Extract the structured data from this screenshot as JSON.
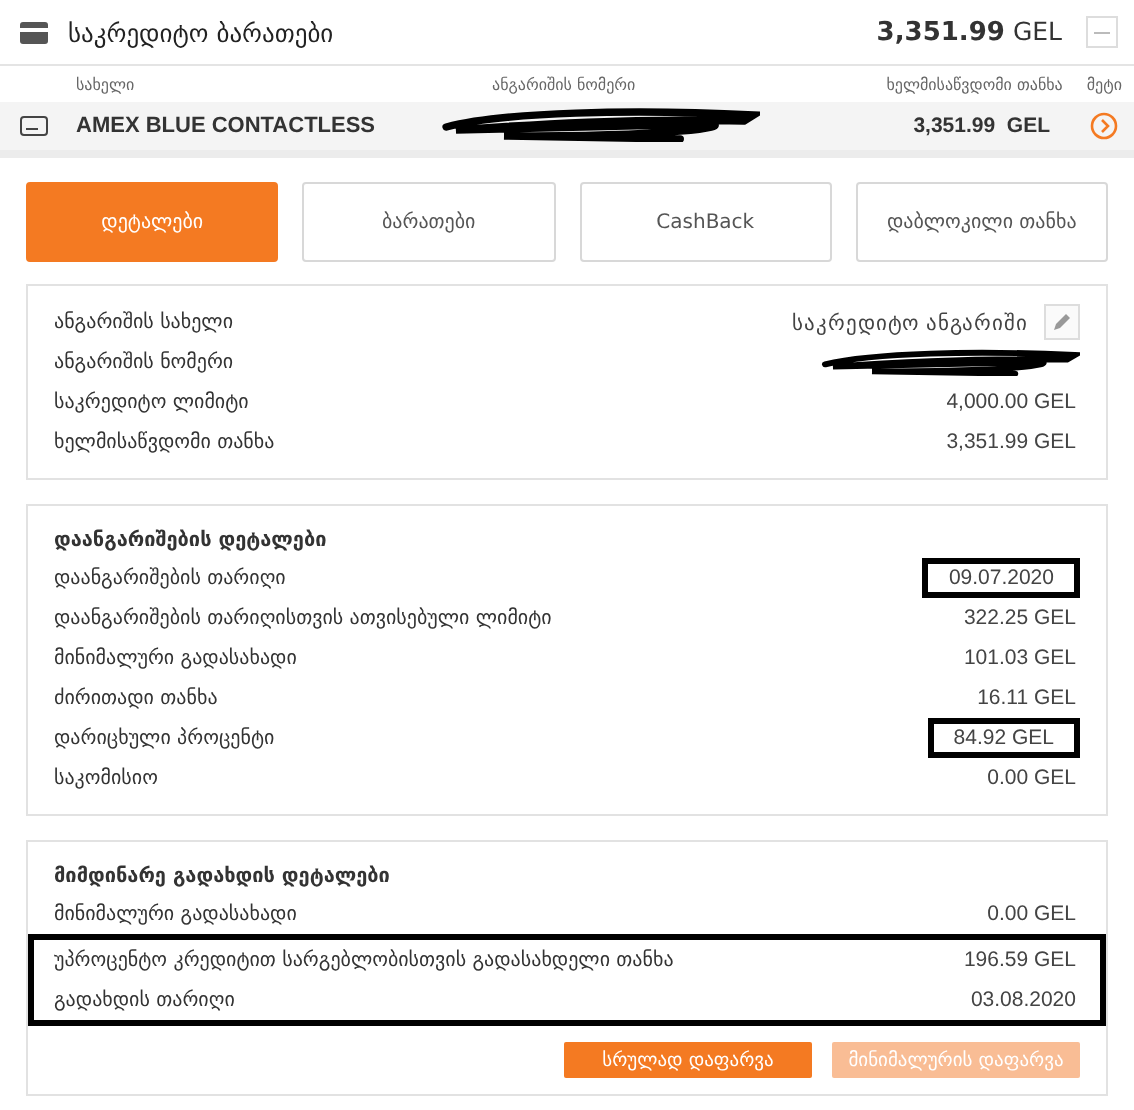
{
  "header": {
    "title": "საკრედიტო ბარათები",
    "amount": "3,351.99",
    "currency": "GEL"
  },
  "columns": [
    "სახელი",
    "ანგარიშის ნომერი",
    "ხელმისაწვდომი თანხა",
    "მეტი"
  ],
  "card": {
    "name": "AMEX BLUE CONTACTLESS",
    "amount": "3,351.99",
    "currency": "GEL",
    "number_redacted": true
  },
  "tabs": [
    {
      "label": "დეტალები",
      "selected": true
    },
    {
      "label": "ბარათები",
      "selected": false
    },
    {
      "label": "CashBack",
      "selected": false
    },
    {
      "label": "დაბლოკილი თანხა",
      "selected": false
    }
  ],
  "sections": [
    {
      "rows": [
        {
          "label": "ანგარიშის სახელი",
          "value": "საკრედიტო ანგარიში",
          "editable": true
        },
        {
          "label": "ანგარიშის ნომერი",
          "redacted": true
        },
        {
          "label": "საკრედიტო ლიმიტი",
          "value": "4,000.00 GEL"
        },
        {
          "label": "ხელმისაწვდომი თანხა",
          "value": "3,351.99 GEL"
        }
      ]
    },
    {
      "title": "დაანგარიშების დეტალები",
      "rows": [
        {
          "label": "დაანგარიშების თარიღი",
          "value": "09.07.2020",
          "value_framed": true
        },
        {
          "label": "დაანგარიშების თარიღისთვის ათვისებული ლიმიტი",
          "value": "322.25 GEL"
        },
        {
          "label": "მინიმალური გადასახადი",
          "value": "101.03 GEL"
        },
        {
          "label": "ძირითადი თანხა",
          "value": "16.11 GEL"
        },
        {
          "label": "დარიცხული პროცენტი",
          "value": "84.92 GEL",
          "value_framed": true
        },
        {
          "label": "საკომისიო",
          "value": "0.00 GEL"
        }
      ]
    },
    {
      "title": "მიმდინარე გადახდის დეტალები",
      "rows": [
        {
          "label": "მინიმალური გადასახადი",
          "value": "0.00 GEL"
        },
        {
          "label": "უპროცენტო კრედიტით სარგებლობისთვის გადასახდელი თანხა",
          "value": "196.59 GEL",
          "row_framed": true
        },
        {
          "label": "გადახდის თარიღი",
          "value": "03.08.2020",
          "row_framed": true
        }
      ],
      "buttons": [
        {
          "label": "სრულად დაფარვა",
          "disabled": false
        },
        {
          "label": "მინიმალურის დაფარვა",
          "disabled": true
        }
      ]
    }
  ]
}
